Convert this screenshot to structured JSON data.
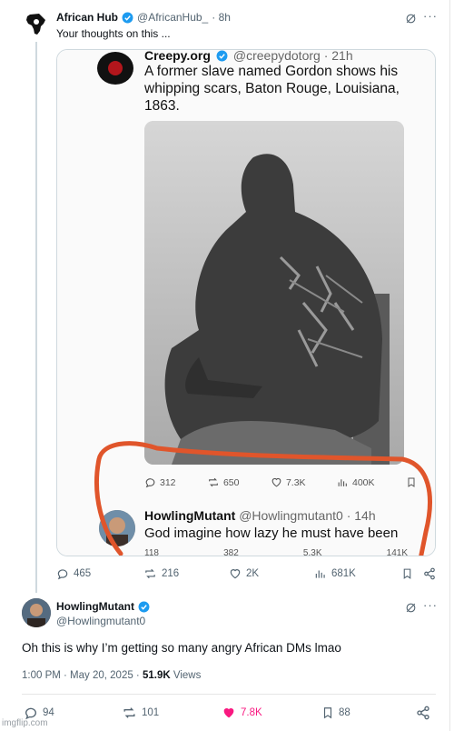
{
  "tweet1": {
    "display_name": "African Hub",
    "handle": "@AfricanHub_",
    "time": "· 8h",
    "text": "Your thoughts on this ...",
    "stats": {
      "replies": "465",
      "reposts": "216",
      "likes": "2K",
      "views": "681K"
    }
  },
  "embedded": {
    "account_name": "Creepy.org",
    "account_handle": "@creepydotorg · 21h",
    "text": "A former slave named Gordon shows his whipping scars, Baton Rouge, Louisiana, 1863.",
    "stats": {
      "replies": "312",
      "reposts": "650",
      "likes": "7.3K",
      "views": "400K"
    },
    "reply": {
      "name": "HowlingMutant",
      "handle": "@Howlingmutant0 · 14h",
      "text": "God imagine how lazy he must have been",
      "stats": {
        "replies": "118",
        "reposts": "382",
        "likes": "5.3K",
        "views": "141K"
      }
    }
  },
  "tweet2": {
    "display_name": "HowlingMutant",
    "handle": "@Howlingmutant0",
    "text": "Oh this is why I’m getting so many angry African DMs lmao",
    "time": "1:00 PM · May 20, 2025 ·",
    "views_count": "51.9K",
    "views_label": "Views",
    "stats": {
      "replies": "94",
      "reposts": "101",
      "likes": "7.8K",
      "bookmarks": "88"
    }
  },
  "watermark": "imgflip.com",
  "colors": {
    "verified": "#1d9bf0",
    "like_active": "#f91880",
    "annotation": "#e0552b"
  }
}
